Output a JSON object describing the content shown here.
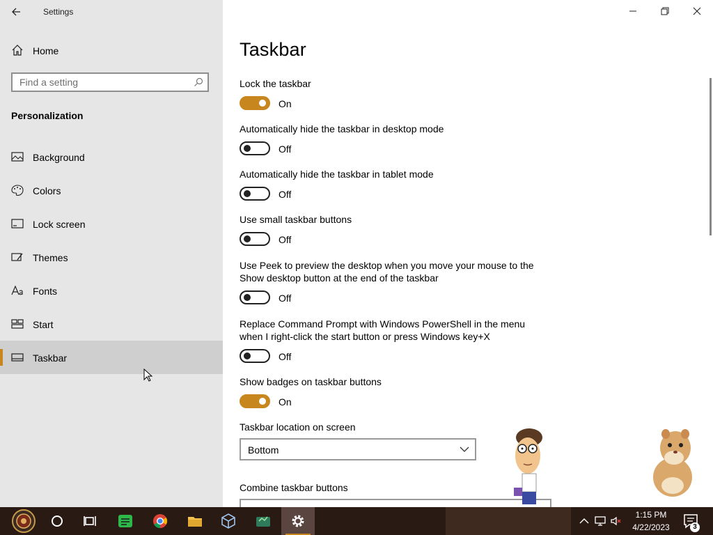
{
  "app": {
    "title": "Settings"
  },
  "sidebar": {
    "home_label": "Home",
    "search_placeholder": "Find a setting",
    "section_title": "Personalization",
    "items": [
      {
        "label": "Background",
        "icon": "picture-icon"
      },
      {
        "label": "Colors",
        "icon": "palette-icon"
      },
      {
        "label": "Lock screen",
        "icon": "lock-screen-icon"
      },
      {
        "label": "Themes",
        "icon": "themes-icon"
      },
      {
        "label": "Fonts",
        "icon": "fonts-icon"
      },
      {
        "label": "Start",
        "icon": "start-icon"
      },
      {
        "label": "Taskbar",
        "icon": "taskbar-icon",
        "active": true
      }
    ]
  },
  "main": {
    "title": "Taskbar",
    "settings": [
      {
        "label": "Lock the taskbar",
        "state": "On"
      },
      {
        "label": "Automatically hide the taskbar in desktop mode",
        "state": "Off"
      },
      {
        "label": "Automatically hide the taskbar in tablet mode",
        "state": "Off"
      },
      {
        "label": "Use small taskbar buttons",
        "state": "Off"
      },
      {
        "label": "Use Peek to preview the desktop when you move your mouse to the Show desktop button at the end of the taskbar",
        "state": "Off"
      },
      {
        "label": "Replace Command Prompt with Windows PowerShell in the menu when I right-click the start button or press Windows key+X",
        "state": "Off"
      },
      {
        "label": "Show badges on taskbar buttons",
        "state": "On"
      }
    ],
    "location_label": "Taskbar location on screen",
    "location_value": "Bottom",
    "combine_label": "Combine taskbar buttons"
  },
  "taskbar": {
    "time": "1:15 PM",
    "date": "4/22/2023",
    "notification_count": "3"
  },
  "colors": {
    "accent": "#c8861f",
    "sidebar_bg": "#e6e6e6",
    "taskbar_bg": "#2a1a14"
  }
}
